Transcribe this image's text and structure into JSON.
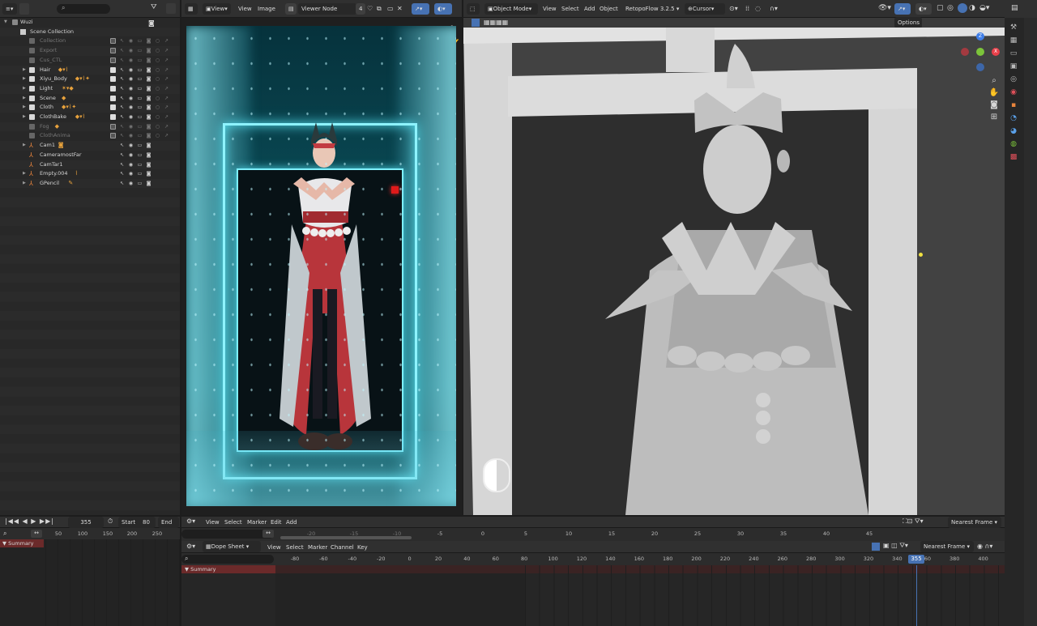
{
  "outliner": {
    "file": "Wuzi",
    "scene_collection": "Scene Collection",
    "items": [
      {
        "label": "Collection",
        "dim": true,
        "expand": false,
        "icon_color": "#777777"
      },
      {
        "label": "Export",
        "dim": true,
        "expand": false,
        "icon_color": "#777777"
      },
      {
        "label": "Cus_CTL",
        "dim": true,
        "expand": false,
        "icon_color": "#777777"
      },
      {
        "label": "Hair",
        "dim": false,
        "expand": true,
        "icon_color": "#dddddd"
      },
      {
        "label": "Xiyu_Body",
        "dim": false,
        "expand": true,
        "icon_color": "#dddddd"
      },
      {
        "label": "Light",
        "dim": false,
        "expand": true,
        "icon_color": "#dddddd"
      },
      {
        "label": "Scene",
        "dim": false,
        "expand": true,
        "icon_color": "#dddddd"
      },
      {
        "label": "Cloth",
        "dim": false,
        "expand": true,
        "icon_color": "#dddddd"
      },
      {
        "label": "ClothBake",
        "dim": false,
        "expand": true,
        "icon_color": "#dddddd"
      },
      {
        "label": "Fog",
        "dim": true,
        "expand": false,
        "icon_color": "#777777"
      },
      {
        "label": "ClothAnima",
        "dim": true,
        "expand": false,
        "icon_color": "#777777"
      },
      {
        "label": "Cam1",
        "dim": false,
        "expand": true,
        "icon_color": "#e8843c"
      },
      {
        "label": "CameramostFar",
        "dim": false,
        "expand": false,
        "icon_color": "#e8843c"
      },
      {
        "label": "CamTar1",
        "dim": false,
        "expand": false,
        "icon_color": "#e8843c"
      },
      {
        "label": "Empty.004",
        "dim": false,
        "expand": true,
        "icon_color": "#e8843c"
      },
      {
        "label": "GPencil",
        "dim": false,
        "expand": true,
        "icon_color": "#e8843c"
      }
    ],
    "search_icon": "search-icon",
    "filter_icon": "filter-icon"
  },
  "image_editor": {
    "menus": [
      "View",
      "View",
      "Image"
    ],
    "image_name": "Viewer Node",
    "slot": "4"
  },
  "viewport": {
    "mode": "Object Mode",
    "menus": [
      "View",
      "Select",
      "Add",
      "Object"
    ],
    "addon": "RetopoFlow 3.2.5",
    "snap": "Cursor",
    "options": "Options"
  },
  "timeline_left": {
    "frame": "355",
    "start_label": "Start",
    "start": "80",
    "end_label": "End",
    "ruler": [
      "50",
      "100",
      "150",
      "200",
      "250"
    ],
    "summary": "Summary"
  },
  "graph": {
    "menus": [
      "View",
      "Select",
      "Marker",
      "Edit",
      "Add"
    ],
    "ruler": [
      "-20",
      "-15",
      "-10",
      "-5",
      "0",
      "5",
      "10",
      "15",
      "20",
      "25",
      "30",
      "35",
      "40",
      "45"
    ],
    "snap": "Nearest Frame"
  },
  "dope_sheet": {
    "mode": "Dope Sheet",
    "menus": [
      "View",
      "Select",
      "Marker",
      "Channel",
      "Key"
    ],
    "snap": "Nearest Frame",
    "ruler": [
      "-80",
      "-60",
      "-40",
      "-20",
      "0",
      "20",
      "40",
      "60",
      "80",
      "100",
      "120",
      "140",
      "160",
      "180",
      "200",
      "220",
      "240",
      "260",
      "280",
      "300",
      "320",
      "340",
      "360",
      "380",
      "400"
    ],
    "current_frame": "355",
    "summary": "Summary"
  },
  "colors": {
    "accent": "#4772b3",
    "summary_red": "#6b2a2a",
    "neon": "#52d8e8"
  }
}
